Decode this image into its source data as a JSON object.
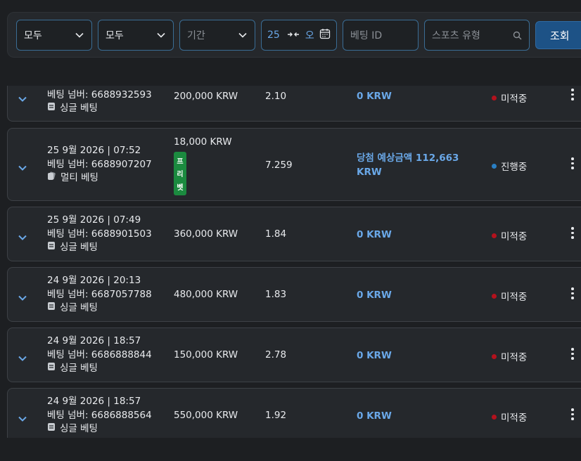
{
  "filters": {
    "select1": "모두",
    "select2": "모두",
    "period_placeholder": "기간",
    "date_from": "25",
    "date_to": "오",
    "bet_id_placeholder": "베팅 ID",
    "sport_placeholder": "스포츠 유형",
    "search_button": "조회"
  },
  "bets": [
    {
      "datetime": "",
      "bet_number": "베팅 넘버: 6688932593",
      "type": "싱글 베팅",
      "amount": "200,000 KRW",
      "odds": "2.10",
      "winnings": "0 KRW",
      "status": "미적중",
      "status_color": "#b3121d"
    },
    {
      "datetime": "25 9월 2026 | 07:52",
      "bet_number": "베팅 넘버: 6688907207",
      "type": "멀티 베팅",
      "amount": "18,000 KRW",
      "freebet": [
        "프",
        "리",
        "벳"
      ],
      "odds": "7.259",
      "winnings": "당첨 예상금액 112,663 KRW",
      "status": "진행중",
      "status_color": "#2a7fc4"
    },
    {
      "datetime": "25 9월 2026 | 07:49",
      "bet_number": "베팅 넘버: 6688901503",
      "type": "싱글 베팅",
      "amount": "360,000 KRW",
      "odds": "1.84",
      "winnings": "0 KRW",
      "status": "미적중",
      "status_color": "#b3121d"
    },
    {
      "datetime": "24 9월 2026 | 20:13",
      "bet_number": "베팅 넘버: 6687057788",
      "type": "싱글 베팅",
      "amount": "480,000 KRW",
      "odds": "1.83",
      "winnings": "0 KRW",
      "status": "미적중",
      "status_color": "#b3121d"
    },
    {
      "datetime": "24 9월 2026 | 18:57",
      "bet_number": "베팅 넘버: 6686888844",
      "type": "싱글 베팅",
      "amount": "150,000 KRW",
      "odds": "2.78",
      "winnings": "0 KRW",
      "status": "미적중",
      "status_color": "#b3121d"
    },
    {
      "datetime": "24 9월 2026 | 18:57",
      "bet_number": "베팅 넘버: 6686888564",
      "type": "싱글 베팅",
      "amount": "550,000 KRW",
      "odds": "1.92",
      "winnings": "0 KRW",
      "status": "미적중",
      "status_color": "#b3121d"
    }
  ],
  "icons": {
    "expand": "chevron-down-icon",
    "calendar": "calendar-icon",
    "search": "search-icon",
    "more": "more-vertical-icon",
    "single": "single-bet-icon",
    "multi": "multi-bet-icon"
  }
}
